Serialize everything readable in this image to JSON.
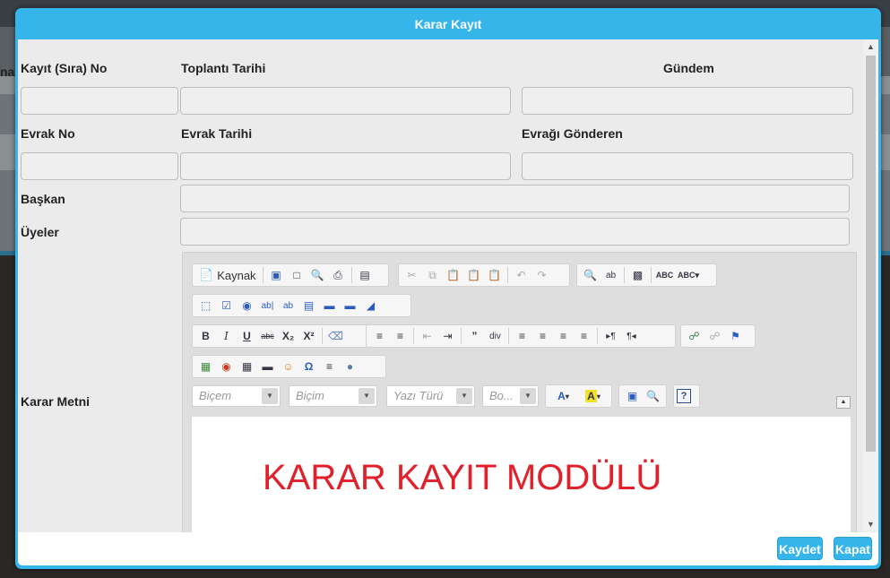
{
  "background": {
    "partial_text": "na"
  },
  "modal": {
    "title": "Karar Kayıt",
    "fields": {
      "kayit_no": "Kayıt (Sıra) No",
      "toplanti_tarihi": "Toplantı Tarihi",
      "gundem": "Gündem",
      "evrak_no": "Evrak No",
      "evrak_tarihi": "Evrak Tarihi",
      "evragi_gonderen": "Evrağı Gönderen",
      "baskan": "Başkan",
      "uyeler": "Üyeler",
      "karar_metni": "Karar Metni"
    },
    "values": {
      "kayit_no": "",
      "toplanti_tarihi": "",
      "gundem": "",
      "evrak_no": "",
      "evrak_tarihi": "",
      "evragi_gonderen": "",
      "baskan": "",
      "uyeler": ""
    },
    "editor": {
      "source_label": "Kaynak",
      "combo_style": "Biçem",
      "combo_format": "Biçim",
      "combo_font": "Yazı Türü",
      "combo_size": "Bo...",
      "content": "KARAR KAYIT MODÜLÜ"
    },
    "buttons": {
      "save": "Kaydet",
      "close": "Kapat"
    }
  },
  "colors": {
    "accent": "#35b5ea",
    "content_text": "#e0202a"
  },
  "icons": {
    "row1": [
      "save-icon",
      "new-page-icon",
      "preview-icon",
      "print-icon",
      "templates-icon",
      "cut-icon",
      "copy-icon",
      "paste-icon",
      "paste-text-icon",
      "paste-word-icon",
      "undo-icon",
      "redo-icon",
      "find-icon",
      "replace-icon",
      "select-all-icon",
      "spellcheck-icon",
      "spellcheck-as-you-type-icon"
    ],
    "row2": [
      "form-icon",
      "checkbox-icon",
      "radio-icon",
      "textfield-icon",
      "textarea-icon",
      "select-icon",
      "button-icon",
      "image-button-icon",
      "hidden-field-icon"
    ],
    "row3": [
      "bold-icon",
      "italic-icon",
      "underline-icon",
      "strike-icon",
      "subscript-icon",
      "superscript-icon",
      "remove-format-icon",
      "numbered-list-icon",
      "bullet-list-icon",
      "outdent-icon",
      "indent-icon",
      "blockquote-icon",
      "div-icon",
      "align-left-icon",
      "align-center-icon",
      "align-right-icon",
      "justify-icon",
      "ltr-icon",
      "rtl-icon",
      "link-icon",
      "unlink-icon",
      "anchor-icon"
    ],
    "row4": [
      "image-icon",
      "flash-icon",
      "table-icon",
      "horizontal-rule-icon",
      "smiley-icon",
      "special-char-icon",
      "page-break-icon",
      "iframe-icon"
    ],
    "row5": [
      "text-color-icon",
      "background-color-icon",
      "maximize-icon",
      "show-blocks-icon",
      "about-icon"
    ]
  }
}
